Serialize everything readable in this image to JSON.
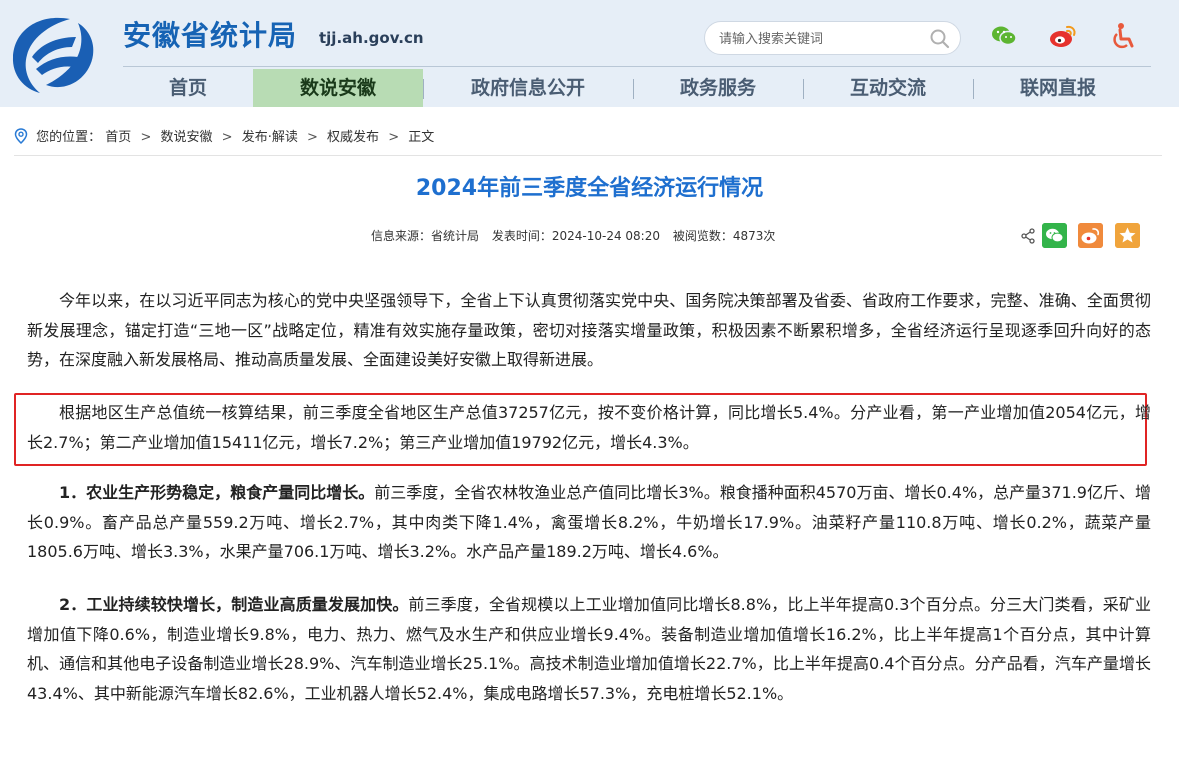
{
  "site": {
    "title": "安徽省统计局",
    "domain": "tjj.ah.gov.cn"
  },
  "search": {
    "placeholder": "请输入搜索关键词"
  },
  "social_icons": [
    "wechat-icon",
    "weibo-icon",
    "accessibility-icon"
  ],
  "nav": {
    "items": [
      {
        "label": "首页",
        "active": false
      },
      {
        "label": "数说安徽",
        "active": true
      },
      {
        "label": "政府信息公开",
        "active": false
      },
      {
        "label": "政务服务",
        "active": false
      },
      {
        "label": "互动交流",
        "active": false
      },
      {
        "label": "联网直报",
        "active": false
      }
    ]
  },
  "breadcrumb": {
    "prefix": "您的位置：",
    "items": [
      "首页",
      "数说安徽",
      "发布·解读",
      "权威发布",
      "正文"
    ],
    "separator": ">"
  },
  "article": {
    "title": "2024年前三季度全省经济运行情况",
    "source": "信息来源：省统计局",
    "publish_time": "发表时间：2024-10-24 08:20",
    "views": "被阅览数：4873次",
    "paragraphs": [
      {
        "bold": "",
        "text": "今年以来，在以习近平同志为核心的党中央坚强领导下，全省上下认真贯彻落实党中央、国务院决策部署及省委、省政府工作要求，完整、准确、全面贯彻新发展理念，锚定打造“三地一区”战略定位，精准有效实施存量政策，密切对接落实增量政策，积极因素不断累积增多，全省经济运行呈现逐季回升向好的态势，在深度融入新发展格局、推动高质量发展、全面建设美好安徽上取得新进展。"
      },
      {
        "bold": "",
        "text": "根据地区生产总值统一核算结果，前三季度全省地区生产总值37257亿元，按不变价格计算，同比增长5.4%。分产业看，第一产业增加值2054亿元，增长2.7%；第二产业增加值15411亿元，增长7.2%；第三产业增加值19792亿元，增长4.3%。"
      },
      {
        "bold": "1．农业生产形势稳定，粮食产量同比增长。",
        "text": "前三季度，全省农林牧渔业总产值同比增长3%。粮食播种面积4570万亩、增长0.4%，总产量371.9亿斤、增长0.9%。畜产品总产量559.2万吨、增长2.7%，其中肉类下降1.4%，禽蛋增长8.2%，牛奶增长17.9%。油菜籽产量110.8万吨、增长0.2%，蔬菜产量1805.6万吨、增长3.3%，水果产量706.1万吨、增长3.2%。水产品产量189.2万吨、增长4.6%。"
      },
      {
        "bold": "2．工业持续较快增长，制造业高质量发展加快。",
        "text": "前三季度，全省规模以上工业增加值同比增长8.8%，比上半年提高0.3个百分点。分三大门类看，采矿业增加值下降0.6%，制造业增长9.8%，电力、热力、燃气及水生产和供应业增长9.4%。装备制造业增加值增长16.2%，比上半年提高1个百分点，其中计算机、通信和其他电子设备制造业增长28.9%、汽车制造业增长25.1%。高技术制造业增加值增长22.7%，比上半年提高0.4个百分点。分产品看，汽车产量增长43.4%、其中新能源汽车增长82.6%，工业机器人增长52.4%，集成电路增长57.3%，充电桩增长52.1%。"
      }
    ]
  },
  "colors": {
    "brand_blue": "#1663b4",
    "title_blue": "#1e6fcf",
    "nav_active_bg": "#b8dcb4",
    "highlight_border": "#e02424"
  }
}
